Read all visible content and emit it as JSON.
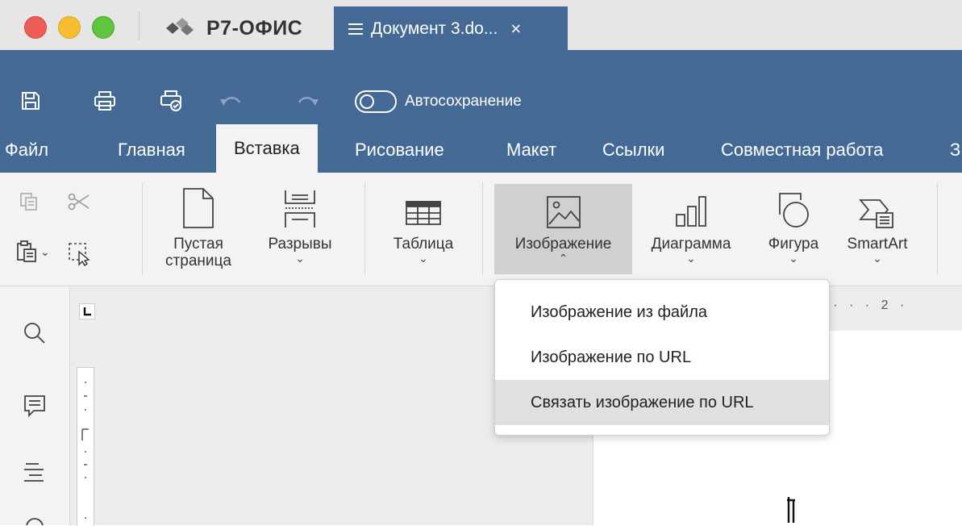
{
  "titlebar": {
    "app_name": "Р7-ОФИС",
    "doc_tab_title": "Документ 3.do...",
    "doc_tab_close": "×"
  },
  "quick_access": {
    "autosave_label": "Автосохранение"
  },
  "menu_tabs": [
    {
      "label": "Файл"
    },
    {
      "label": "Главная"
    },
    {
      "label": "Вставка",
      "active": true
    },
    {
      "label": "Рисование"
    },
    {
      "label": "Макет"
    },
    {
      "label": "Ссылки"
    },
    {
      "label": "Совместная работа"
    },
    {
      "label": "З"
    }
  ],
  "ribbon": {
    "blank_page_line1": "Пустая",
    "blank_page_line2": "страница",
    "breaks": "Разрывы",
    "table": "Таблица",
    "image": "Изображение",
    "chart": "Диаграмма",
    "shape": "Фигура",
    "smartart": "SmartArt"
  },
  "image_menu": {
    "items": [
      {
        "label": "Изображение из файла"
      },
      {
        "label": "Изображение по URL"
      },
      {
        "label": "Связать изображение по URL",
        "highlighted": true
      }
    ]
  },
  "ruler": {
    "h_text": "1 · · · 2 ·",
    "corner": "L"
  },
  "colors": {
    "toolbar_bg": "#446995",
    "ribbon_bg": "#f3f3f3",
    "highlight": "#e0e0e0"
  }
}
